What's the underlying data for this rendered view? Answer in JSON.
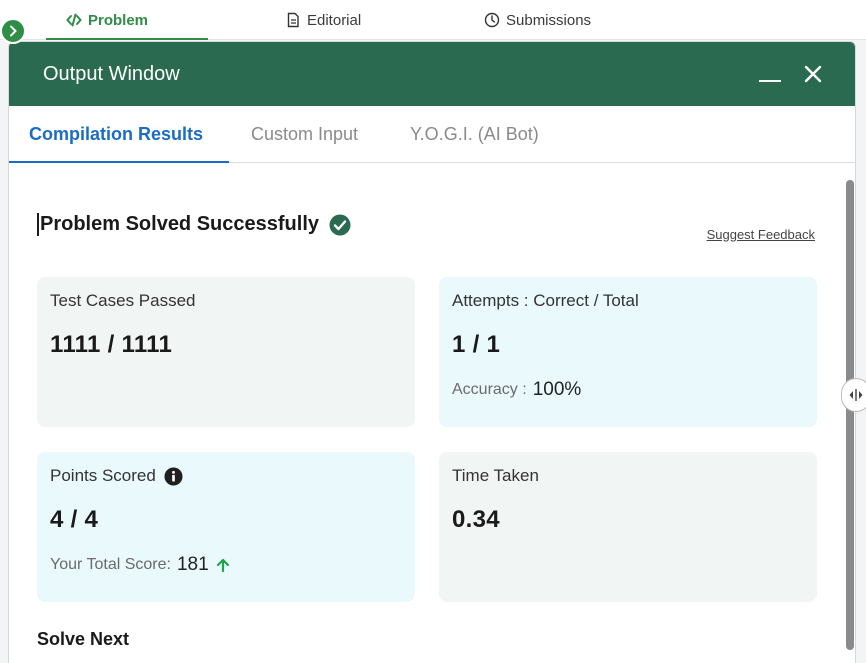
{
  "top_tabs": {
    "problem": "Problem",
    "editorial": "Editorial",
    "submissions": "Submissions"
  },
  "output_window": {
    "title": "Output Window",
    "tabs": [
      "Compilation Results",
      "Custom Input",
      "Y.O.G.I. (AI Bot)"
    ],
    "status": "Problem Solved Successfully",
    "suggest_feedback": "Suggest Feedback",
    "cards": {
      "test_cases": {
        "label": "Test Cases Passed",
        "value": "1111 / 1111"
      },
      "attempts": {
        "label": "Attempts : Correct / Total",
        "value": "1 / 1",
        "accuracy_label": "Accuracy :",
        "accuracy_value": "100%"
      },
      "points": {
        "label": "Points Scored",
        "value": "4 / 4",
        "total_label": "Your Total Score:",
        "total_value": "181"
      },
      "time": {
        "label": "Time Taken",
        "value": "0.34"
      }
    },
    "solve_next": "Solve Next"
  },
  "colors": {
    "brand_green": "#2f8d46",
    "header_green": "#2a6a50",
    "active_tab_blue": "#1b6cc4",
    "card_grey": "#f1f5f3",
    "card_blue": "#e9f9fc"
  },
  "icons": [
    "code-icon",
    "document-icon",
    "clock-icon",
    "chevron-right-icon",
    "minimize-icon",
    "close-icon",
    "check-circle-icon",
    "info-icon",
    "arrow-up-icon",
    "resize-handle-icon"
  ]
}
